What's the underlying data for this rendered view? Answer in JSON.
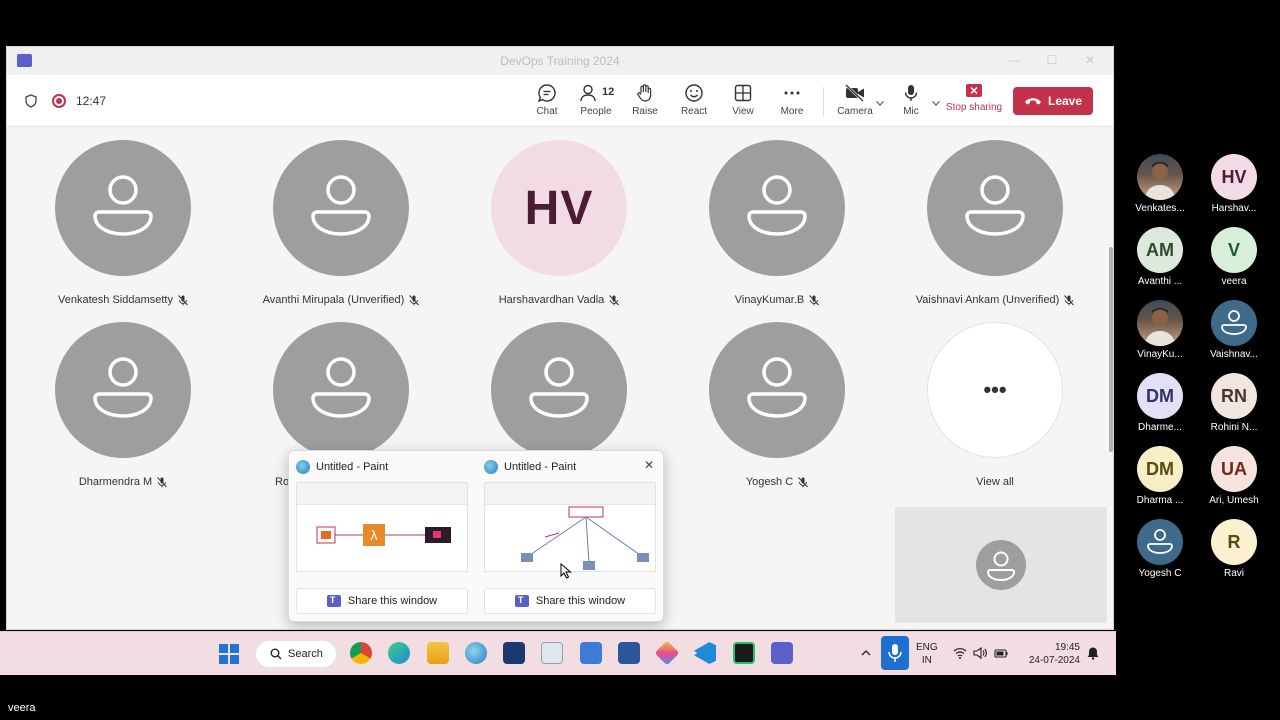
{
  "window": {
    "title": "DevOps Training 2024",
    "timer": "12:47",
    "controls": {
      "minimize": "—",
      "maximize": "☐",
      "close": "✕"
    }
  },
  "toolbar": {
    "chat": "Chat",
    "people": "People",
    "people_count": "12",
    "raise": "Raise",
    "react": "React",
    "view": "View",
    "more": "More",
    "camera": "Camera",
    "mic": "Mic",
    "stop_sharing": "Stop sharing",
    "leave": "Leave"
  },
  "colors": {
    "leave": "#c4314b",
    "stop_sharing": "#c4314b",
    "teams_brand": "#5b5fc7"
  },
  "gallery": [
    {
      "name": "Venkatesh Siddamsetty",
      "type": "icon"
    },
    {
      "name": "Avanthi Mirupala (Unverified)",
      "type": "icon"
    },
    {
      "name": "Harshavardhan Vadla",
      "type": "initials",
      "initials": "HV"
    },
    {
      "name": "VinayKumar.B",
      "type": "icon"
    },
    {
      "name": "Vaishnavi Ankam (Unverified)",
      "type": "icon"
    },
    {
      "name": "Dharmendra M",
      "type": "icon"
    },
    {
      "name": "Rohi",
      "type": "icon"
    },
    {
      "name": "",
      "type": "icon"
    },
    {
      "name": "Yogesh C",
      "type": "icon"
    },
    {
      "name": "View all",
      "type": "more",
      "glyph": "•••"
    }
  ],
  "popup": {
    "windows": [
      {
        "title": "Untitled - Paint",
        "share": "Share this window"
      },
      {
        "title": "Untitled - Paint",
        "share": "Share this window"
      }
    ],
    "close": "✕"
  },
  "taskbar": {
    "search": "Search",
    "lang_top": "ENG",
    "lang_bottom": "IN",
    "time": "19:45",
    "date": "24-07-2024"
  },
  "side_participants": [
    {
      "short": "Venkates...",
      "initials": "",
      "kind": "photo"
    },
    {
      "short": "Harshav...",
      "initials": "HV",
      "kind": "initials",
      "bg": "#f3dbe6",
      "fg": "#4a1d33"
    },
    {
      "short": "Avanthi ...",
      "initials": "AM",
      "kind": "initials",
      "bg": "#dde9dc",
      "fg": "#2e4a2c"
    },
    {
      "short": "veera",
      "initials": "V",
      "kind": "initials",
      "bg": "#d7efd9",
      "fg": "#1f5a2a"
    },
    {
      "short": "VinayKu...",
      "initials": "",
      "kind": "photo"
    },
    {
      "short": "Vaishnav...",
      "initials": "",
      "kind": "icon"
    },
    {
      "short": "Dharme...",
      "initials": "DM",
      "kind": "initials",
      "bg": "#e1e0f5",
      "fg": "#33306b"
    },
    {
      "short": "Rohini N...",
      "initials": "RN",
      "kind": "initials",
      "bg": "#efe6e0",
      "fg": "#4a3428"
    },
    {
      "short": "Dharma ...",
      "initials": "DM",
      "kind": "initials",
      "bg": "#f6efc7",
      "fg": "#5a4a12"
    },
    {
      "short": "Ari, Umesh",
      "initials": "UA",
      "kind": "initials",
      "bg": "#f7e3dd",
      "fg": "#6b2a1c"
    },
    {
      "short": "Yogesh C",
      "initials": "",
      "kind": "icon"
    },
    {
      "short": "Ravi",
      "initials": "R",
      "kind": "initials",
      "bg": "#fbf0cf",
      "fg": "#5c4810"
    }
  ],
  "footer": {
    "name": "veera"
  }
}
